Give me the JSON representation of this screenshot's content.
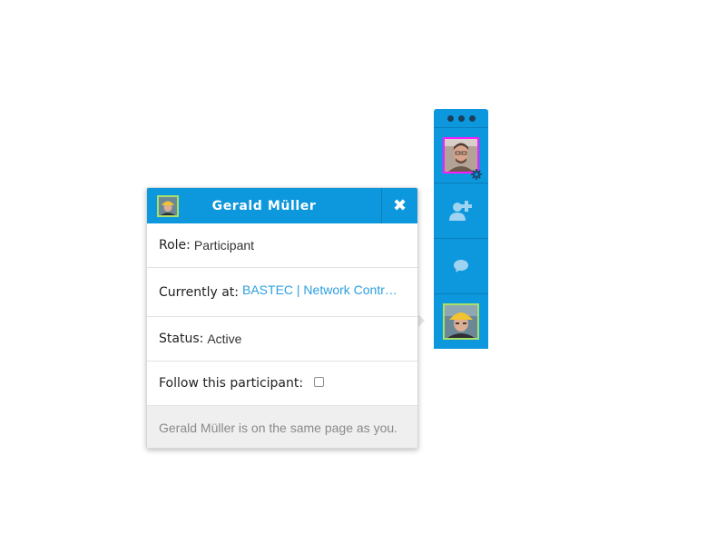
{
  "toolbar": {
    "menu_icon": "ellipsis-icon",
    "self_avatar_icon": "user-photo",
    "settings_icon": "gear-icon",
    "add_participant_icon": "add-user-icon",
    "chat_icon": "chat-bubble-icon",
    "peer_avatar_icon": "user-photo-hardhat",
    "colors": {
      "background": "#0d97dc",
      "self_border": "#ff19ff",
      "peer_border": "#a8e06a"
    }
  },
  "popup": {
    "title": "Gerald Müller",
    "close_icon": "close-icon",
    "role_label": "Role:",
    "role_value": "Participant",
    "location_label": "Currently at:",
    "location_value": "BASTEC | Network Control...",
    "status_label": "Status:",
    "status_value": "Active",
    "follow_label": "Follow this participant:",
    "follow_checked": false,
    "footer_text": "Gerald Müller is on the same page as you."
  }
}
